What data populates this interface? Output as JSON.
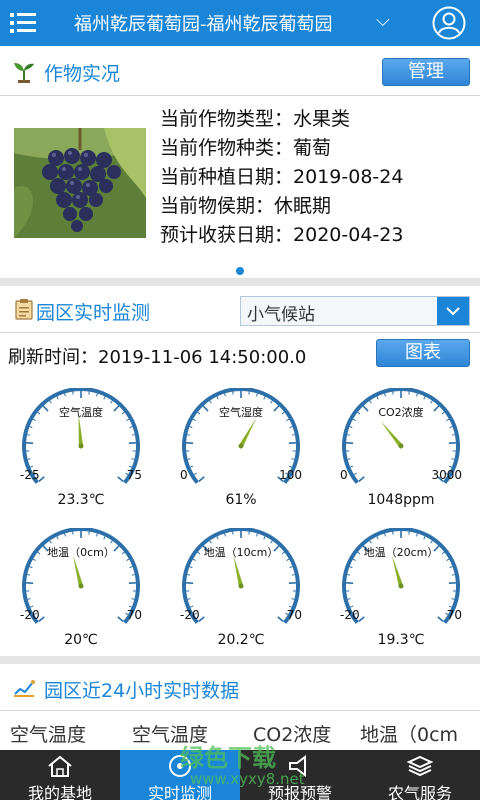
{
  "header": {
    "title": "福州乾辰葡萄园-福州乾辰葡萄园",
    "caret": "⌵",
    "bar_color": "#1b86d8"
  },
  "crop": {
    "section_title": "作物实况",
    "manage_button": "管理",
    "rows": [
      {
        "label": "当前作物类型：",
        "value": "水果类"
      },
      {
        "label": "当前作物种类：",
        "value": "葡萄"
      },
      {
        "label": "当前种植日期：",
        "value": "2019-08-24"
      },
      {
        "label": "当前物侯期：",
        "value": "休眠期"
      },
      {
        "label": "预计收获日期：",
        "value": "2020-04-23"
      }
    ]
  },
  "monitor": {
    "section_title": "园区实时监测",
    "station_select": "小气候站",
    "refresh_label": "刷新时间：",
    "refresh_time": "2019-11-06 14:50:00.0",
    "chart_button": "图表",
    "gauges": [
      {
        "name": "空气温度",
        "min": "-25",
        "max": "75",
        "value": 23.3,
        "display": "23.3℃",
        "range": [
          -25,
          75
        ]
      },
      {
        "name": "空气湿度",
        "min": "0",
        "max": "100",
        "value": 61,
        "display": "61%",
        "range": [
          0,
          100
        ]
      },
      {
        "name": "CO2浓度",
        "min": "0",
        "max": "3000",
        "value": 1048,
        "display": "1048ppm",
        "range": [
          0,
          3000
        ]
      },
      {
        "name": "地温（0cm）",
        "min": "-20",
        "max": "70",
        "value": 20,
        "display": "20℃",
        "range": [
          -20,
          70
        ]
      },
      {
        "name": "地温（10cm）",
        "min": "-20",
        "max": "70",
        "value": 20.2,
        "display": "20.2℃",
        "range": [
          -20,
          70
        ]
      },
      {
        "name": "地温（20cm）",
        "min": "-20",
        "max": "70",
        "value": 19.3,
        "display": "19.3℃",
        "range": [
          -20,
          70
        ]
      }
    ]
  },
  "history": {
    "section_title": "园区近24小时实时数据",
    "columns": [
      "空气温度",
      "空气温度",
      "CO2浓度",
      "地温（0cm"
    ]
  },
  "tabs": [
    {
      "label": "我的基地",
      "icon": "home-icon",
      "active": false
    },
    {
      "label": "实时监测",
      "icon": "monitor-icon",
      "active": true
    },
    {
      "label": "预报预警",
      "icon": "warning-icon",
      "active": false
    },
    {
      "label": "农气服务",
      "icon": "layers-icon",
      "active": false
    }
  ],
  "watermark": {
    "text": "绿色下载",
    "url": "www.xyxy8.net"
  }
}
